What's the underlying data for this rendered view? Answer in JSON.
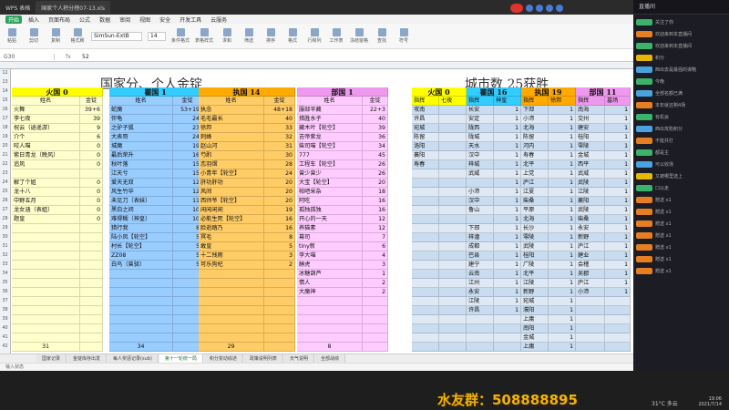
{
  "window": {
    "tabs": [
      "WPS 表格",
      "国家个人积分榜07-13.xls"
    ],
    "menus": [
      "开始",
      "插入",
      "页面布局",
      "公式",
      "数据",
      "审阅",
      "视图",
      "安全",
      "开发工具",
      "云服务"
    ],
    "font_name": "SimSun-ExtB",
    "font_size": "14",
    "ribbon_labels": [
      "粘贴",
      "剪切",
      "复制",
      "格式刷",
      "条件格式",
      "表格样式",
      "求和",
      "筛选",
      "排序",
      "格式",
      "行和列",
      "工作表",
      "冻结窗格",
      "查找",
      "符号"
    ],
    "namebox": "G30",
    "formula_value": "52"
  },
  "sheet": {
    "title_left": "国家分、个人金锭",
    "title_right": "城市数 25获胜",
    "row_numbers": [
      "12",
      "13",
      "14",
      "15",
      "16",
      "17",
      "18",
      "19",
      "20",
      "21",
      "22",
      "23",
      "24",
      "25",
      "26",
      "27",
      "28",
      "29",
      "30",
      "31",
      "32",
      "33",
      "34",
      "35",
      "36",
      "37",
      "38",
      "39",
      "40",
      "41",
      "42"
    ],
    "countries": [
      {
        "name": "火国",
        "score": "0",
        "header_color": "#ffff00",
        "body_color": "#ffffcc"
      },
      {
        "name": "瞿国",
        "score": "1",
        "header_color": "#33ccff",
        "body_color": "#99ccff"
      },
      {
        "name": "执国",
        "score": "14",
        "header_color": "#ffaa00",
        "body_color": "#ffcc66"
      },
      {
        "name": "部国",
        "score": "1",
        "header_color": "#ee99ee",
        "body_color": "#ffccff"
      }
    ],
    "col_labels": [
      "姓名",
      "金锭"
    ],
    "fire": {
      "rows": [
        [
          "火舞",
          "39+6"
        ],
        [
          "李七夜",
          "39"
        ],
        [
          "祝云（逍遥游）",
          "9"
        ],
        [
          "介个",
          "6"
        ],
        [
          "咬人喵",
          "0"
        ],
        [
          "紫日青龙（晚风）",
          "0"
        ],
        [
          "追风",
          "0"
        ],
        [
          "",
          ""
        ],
        [
          "解了个姐",
          "0"
        ],
        [
          "龙十八",
          "0"
        ],
        [
          "中野五月",
          "0"
        ],
        [
          "龙女涵（表姐）",
          "0"
        ],
        [
          "题皇",
          "0"
        ]
      ],
      "total": "31"
    },
    "blue": {
      "rows": [
        [
          "蛇魔",
          "53+19"
        ],
        [
          "伴龟",
          "24"
        ],
        [
          "之驴子狐",
          "23"
        ],
        [
          "大表哥",
          "24"
        ],
        [
          "城魔",
          "19"
        ],
        [
          "最后荣升",
          "16"
        ],
        [
          "秋叶落",
          "15"
        ],
        [
          "江天兮",
          "15"
        ],
        [
          "爱天无双",
          "12"
        ],
        [
          "风生竹华",
          "12"
        ],
        [
          "未见刀（表妹）",
          "11"
        ],
        [
          "黑白之间",
          "10"
        ],
        [
          "难得糊（神皇）",
          "10"
        ],
        [
          "猎行我",
          "8"
        ],
        [
          "陆小凤【轮空】",
          "5"
        ],
        [
          "村长【轮空】",
          "5"
        ],
        [
          "ZZ08",
          "5"
        ],
        [
          "白鸟（曾驿）",
          "5"
        ]
      ],
      "total": "34"
    },
    "orange": {
      "rows": [
        [
          "执念",
          "48+18"
        ],
        [
          "毛毛最长",
          "40"
        ],
        [
          "徐邦",
          "33"
        ],
        [
          "刺蜂",
          "32"
        ],
        [
          "赵山河",
          "31"
        ],
        [
          "芍酌",
          "30"
        ],
        [
          "恋羽熠",
          "28"
        ],
        [
          "小青年【轮空】",
          "24"
        ],
        [
          "肝功肝功",
          "20"
        ],
        [
          "风间",
          "20"
        ],
        [
          "西师爷【轮空】",
          "20"
        ],
        [
          "闲闲闲闲",
          "19"
        ],
        [
          "必能生死【轮空】",
          "16"
        ],
        [
          "脸逝踏乃",
          "16"
        ],
        [
          "冥毛",
          "8"
        ],
        [
          "敢皇",
          "5"
        ],
        [
          "十二残雨",
          "3"
        ],
        [
          "可乐狗杞",
          "2"
        ]
      ],
      "total": "29"
    },
    "pink": {
      "rows": [
        [
          "服部半藏",
          "22+3"
        ],
        [
          "措胜水子",
          "40"
        ],
        [
          "藏木叶【轮空】",
          "39"
        ],
        [
          "吉帝紫龙",
          "36"
        ],
        [
          "柴司喵【轮空】",
          "34"
        ],
        [
          "777",
          "45"
        ],
        [
          "工程车【轮空】",
          "26"
        ],
        [
          "曾少曾少",
          "26"
        ],
        [
          "大宝【轮空】",
          "20"
        ],
        [
          "帕吧采杂",
          "18"
        ],
        [
          "阿吃",
          "16"
        ],
        [
          "孤独孤独",
          "16"
        ],
        [
          "开心的一天",
          "12"
        ],
        [
          "养猫素",
          "12"
        ],
        [
          "幕司",
          "7"
        ],
        [
          "tiny新",
          "6"
        ],
        [
          "李大喵",
          "4"
        ],
        [
          "醇虎",
          "3"
        ],
        [
          "冰糖葫芦",
          "1"
        ],
        [
          "情人",
          "2"
        ],
        [
          "大魔神",
          "2"
        ]
      ],
      "total": "8"
    },
    "city_countries": [
      {
        "name": "火国",
        "score": "0",
        "color": "#ffff00"
      },
      {
        "name": "瞿国",
        "score": "16",
        "color": "#33ccff"
      },
      {
        "name": "执国",
        "score": "19",
        "color": "#ffaa00"
      },
      {
        "name": "部国",
        "score": "11",
        "color": "#ee99ee"
      }
    ],
    "city_col_labels": [
      "指挥",
      "七夜",
      "指挥",
      "神皇",
      "指挥",
      "徐邦",
      "指挥",
      "墓场"
    ],
    "city_fire_a": [
      "攻南",
      "许昌",
      "宛城",
      "陈留",
      "洛阳",
      "襄阳",
      "寿春"
    ],
    "city_fire_b": [
      "",
      "",
      "",
      "",
      "",
      "",
      ""
    ],
    "city_blue_a": [
      "长安",
      "安定",
      "陇西",
      "陇城",
      "天水",
      "汉中",
      "梓城",
      "武威",
      "",
      "小沛",
      "汉中",
      "鲁山",
      "",
      "下邳",
      "梓潼",
      "成都",
      "巴县",
      "建宁",
      "云南",
      "江州",
      "永安",
      "江陵",
      "许昌"
    ],
    "city_blue_b": [
      "1",
      "1",
      "1",
      "1",
      "1",
      "1",
      "1",
      "1",
      "1",
      "1",
      "1",
      "1",
      "1",
      "1",
      "1",
      "1",
      "1",
      "1",
      "1",
      "1",
      "1",
      "1",
      "1"
    ],
    "city_orange_a": [
      "下邳",
      "小沛",
      "北海",
      "陈留",
      "河内",
      "寿春",
      "北平",
      "上党",
      "庐江",
      "江夏",
      "柴桑",
      "平原",
      "北海",
      "长沙",
      "零陵",
      "武陵",
      "桂阳",
      "广陵",
      "北平",
      "江陵",
      "新野",
      "宛城",
      "濮阳",
      "上庸",
      "南阳",
      "金城",
      "上庸"
    ],
    "city_orange_b": [
      "1",
      "1",
      "1",
      "1",
      "1",
      "1",
      "1",
      "1",
      "1",
      "1",
      "1",
      "1",
      "1",
      "1",
      "1",
      "1",
      "1",
      "1",
      "1",
      "1",
      "1",
      "1",
      "1",
      "1",
      "1",
      "1",
      "1"
    ],
    "city_pink_a": [
      "南海",
      "交州",
      "建安",
      "桂阳",
      "零陵",
      "金城",
      "西平",
      "武威",
      "武陵",
      "江陵",
      "襄阳",
      "武陵",
      "柴桑",
      "永安",
      "新野",
      "庐江",
      "建业",
      "会稽",
      "吴郡",
      "庐江",
      "小沛"
    ],
    "city_pink_b": [
      "1",
      "1",
      "1",
      "1",
      "1",
      "1",
      "1",
      "1",
      "1",
      "1",
      "1",
      "1",
      "1",
      "1",
      "1",
      "1",
      "1",
      "1",
      "1",
      "1",
      "1"
    ]
  },
  "sheet_tabs": [
    "国家记录",
    "金锭库存出发",
    "每人奖惩记录(sub)",
    "第十一轮统一局",
    "积分变动综述",
    "政策说明列表",
    "天气说明",
    "全部战绩"
  ],
  "active_tab": "第十一轮统一局",
  "status_text": "输入状态",
  "fans_text": "水友群：508888895",
  "clock": {
    "time": "19:06",
    "date": "2021/7/14",
    "weather": "31°C 多云"
  },
  "chat": {
    "header": "直播间",
    "messages": [
      {
        "color": "#3bb36b",
        "text": "关注了你"
      },
      {
        "color": "#e67e22",
        "text": "欢迎来到本直播间"
      },
      {
        "color": "#3bb36b",
        "text": "欢迎来到本直播间"
      },
      {
        "color": "#e6b800",
        "text": "积分"
      },
      {
        "color": "#4aa3df",
        "text": "西出去是最强的谋略"
      },
      {
        "color": "#3bb36b",
        "text": "今晚"
      },
      {
        "color": "#4aa3df",
        "text": "全部名额已满"
      },
      {
        "color": "#e67e22",
        "text": "本年就还剩4场"
      },
      {
        "color": "#3bb36b",
        "text": "有机会"
      },
      {
        "color": "#4aa3df",
        "text": "西出攻陷积分"
      },
      {
        "color": "#e67e22",
        "text": "不能共打"
      },
      {
        "color": "#3bb36b",
        "text": "都是主"
      },
      {
        "color": "#4aa3df",
        "text": "可以收场"
      },
      {
        "color": "#e6b800",
        "text": "又被哪里选上"
      },
      {
        "color": "#3bb36b",
        "text": "口以走"
      },
      {
        "color": "#e67e22",
        "text": "赠送 x1"
      },
      {
        "color": "#e67e22",
        "text": "赠送 x1"
      },
      {
        "color": "#e67e22",
        "text": "赠送 x1"
      },
      {
        "color": "#e67e22",
        "text": "赠送 x1"
      },
      {
        "color": "#e67e22",
        "text": "赠送 x1"
      },
      {
        "color": "#e67e22",
        "text": "赠送 x1"
      },
      {
        "color": "#e67e22",
        "text": "赠送 x1"
      }
    ]
  }
}
